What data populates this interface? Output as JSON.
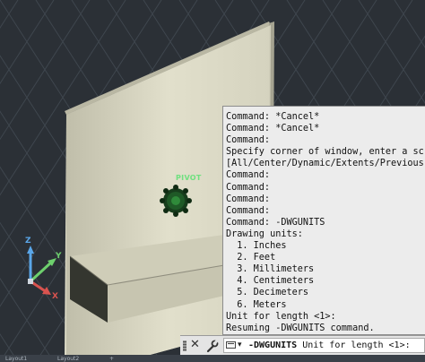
{
  "viewport": {
    "pivot_label": "PIVOT",
    "ucs": {
      "z_label": "Z",
      "y_label": "Y",
      "x_label": "X"
    }
  },
  "command_history": {
    "lines": [
      "Command: *Cancel*",
      "Command: *Cancel*",
      "Command:",
      "Specify corner of window, enter a sc",
      "[All/Center/Dynamic/Extents/Previous",
      "Command:",
      "Command:",
      "Command:",
      "Command:",
      "Command: -DWGUNITS",
      "Drawing units:",
      "  1. Inches",
      "  2. Feet",
      "  3. Millimeters",
      "  4. Centimeters",
      "  5. Decimeters",
      "  6. Meters",
      "Unit for length <1>:",
      "Resuming -DWGUNITS command."
    ]
  },
  "command_line": {
    "close_glyph": "✕",
    "dropdown_glyph": "▾",
    "command_name": "-DWGUNITS",
    "prompt": " Unit for length <1>:"
  },
  "layout_tabs": [
    "Layout1",
    "Layout2",
    "+"
  ],
  "colors": {
    "background": "#2b3036",
    "grid": "#3e454d",
    "wall_front": "#dcdac6",
    "pivot_green": "#6fe07f",
    "ucs_x": "#d9534f",
    "ucs_y": "#6dd06d",
    "ucs_z": "#5aa6e8"
  }
}
